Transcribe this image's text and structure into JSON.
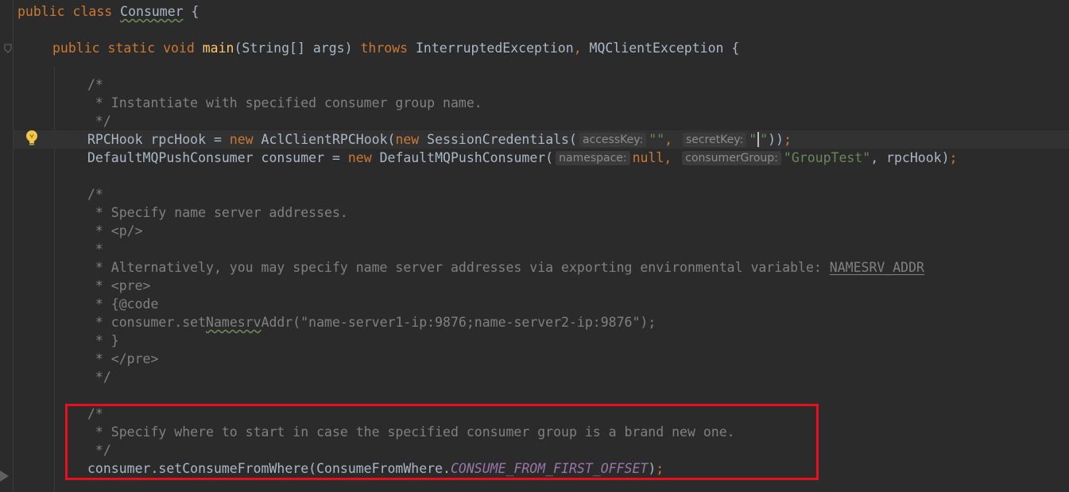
{
  "code": {
    "l1": {
      "kw": "public class ",
      "name": "Consumer",
      "brace": " {"
    },
    "l2": {
      "kw1": "public static void ",
      "fn": "main",
      "p1": "(String[] args) ",
      "kw2": "throws",
      "p2": " InterruptedException",
      "comma": ",",
      "p3": " MQClientException {"
    },
    "c1": {
      "open": "/*",
      "body": " * Instantiate with specified consumer group name.",
      "close": " */"
    },
    "l3": {
      "a": "RPCHook rpcHook = ",
      "new1": "new",
      "b": " AclClientRPCHook(",
      "new2": "new",
      "c": " SessionCredentials(",
      "hint1": "accessKey:",
      "s1": "\"\"",
      "comma": ",",
      "hint2": "secretKey:",
      "s2a": "\"",
      "s2b": "\"",
      "end1": "))",
      "semi": ";"
    },
    "l4": {
      "a": "DefaultMQPushConsumer consumer = ",
      "new1": "new",
      "b": " DefaultMQPushConsumer(",
      "hint1": "namespace:",
      "nul": "null",
      "comma": ",",
      "hint2": "consumerGroup:",
      "s": "\"GroupTest\"",
      "c": ", rpcHook)",
      "semi": ";"
    },
    "c2": {
      "open": "/*",
      "l1": " * Specify name server addresses.",
      "l2": " * <p/>",
      "l3": " *",
      "l4a": " * Alternatively, you may specify name server addresses via exporting environmental variable: ",
      "l4b": "NAMESRV_ADDR",
      "l5": " * <pre>",
      "l6": " * {@code",
      "l7a": " * consumer.set",
      "l7b": "Namesrv",
      "l7c": "Addr(\"name-server1-ip:9876;name-server2-ip:9876\");",
      "l8": " * }",
      "l9": " * </pre>",
      "close": " */"
    },
    "c3": {
      "open": "/*",
      "body": " * Specify where to start in case the specified consumer group is a brand new one.",
      "close": " */"
    },
    "l5": {
      "a": "consumer.setConsumeFromWhere(ConsumeFromWhere.",
      "cst": "CONSUME_FROM_FIRST_OFFSET",
      "b": ")",
      "semi": ";"
    }
  },
  "colors": {
    "background": "#2b2b2b",
    "keyword": "#cc7832",
    "comment": "#808080",
    "string": "#6a8759",
    "constant": "#9876aa",
    "highlight": "#e8101f"
  },
  "icons": [
    "lightbulb-icon",
    "fold-marker-icon",
    "gutter-arrow-icon"
  ]
}
